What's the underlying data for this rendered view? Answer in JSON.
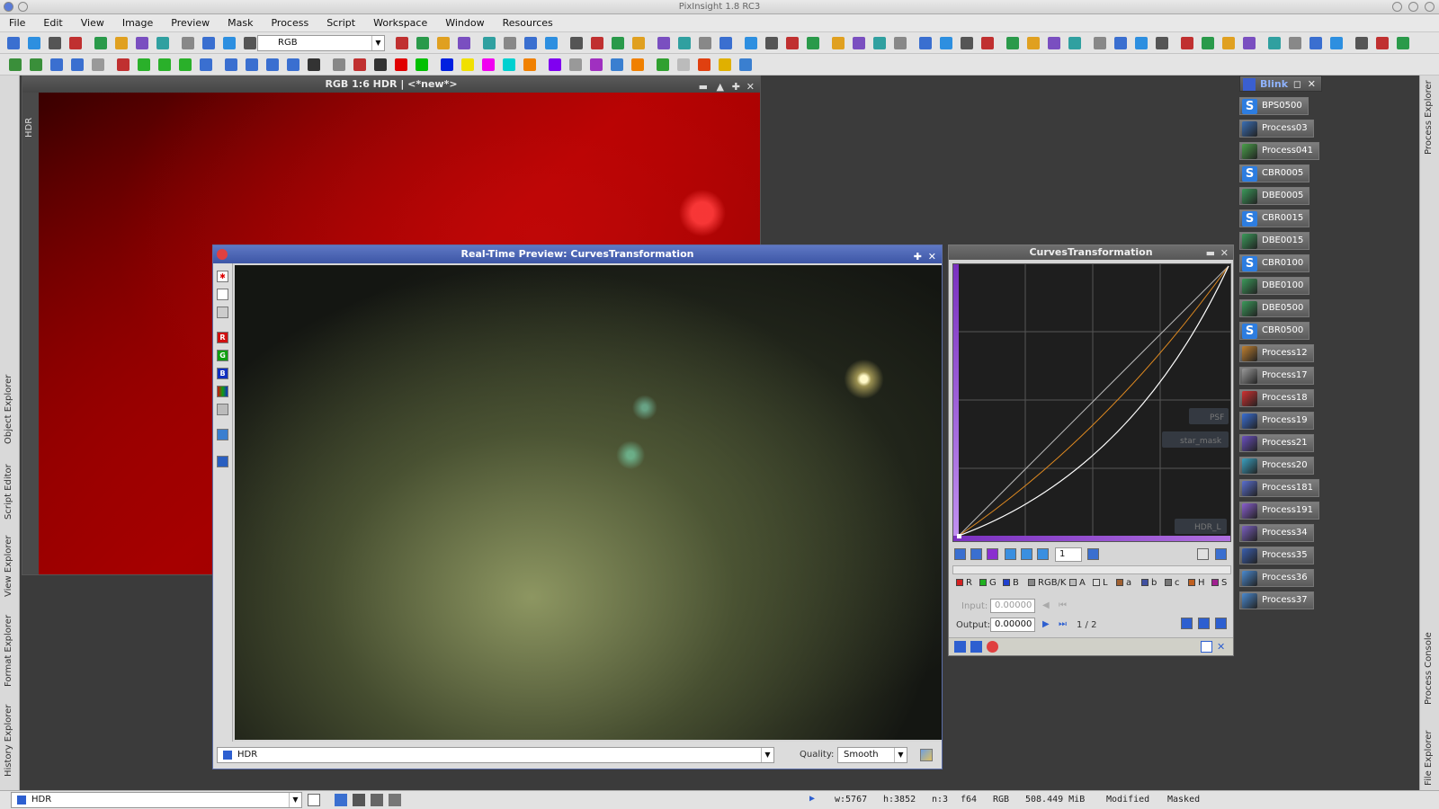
{
  "app": {
    "title": "PixInsight 1.8 RC3"
  },
  "menu": [
    "File",
    "Edit",
    "View",
    "Image",
    "Preview",
    "Mask",
    "Process",
    "Script",
    "Workspace",
    "Window",
    "Resources"
  ],
  "toolbar": {
    "channel_select": "RGB"
  },
  "left_tabs": [
    "Object Explorer",
    "Script Editor",
    "View Explorer",
    "Format Explorer",
    "History Explorer"
  ],
  "right_tabs": [
    "Process Explorer",
    "Process Console",
    "File Explorer"
  ],
  "image_window": {
    "title": "RGB 1:6 HDR | <*new*>",
    "side_tab": "HDR"
  },
  "preview_window": {
    "title": "Real-Time Preview: CurvesTransformation",
    "view_select": "HDR",
    "quality_label": "Quality:",
    "quality_value": "Smooth",
    "tools": [
      "R",
      "G",
      "B"
    ]
  },
  "curves_window": {
    "title": "CurvesTransformation",
    "zoom_value": "1",
    "channels": [
      {
        "label": "R",
        "color": "#d42020"
      },
      {
        "label": "G",
        "color": "#20b020"
      },
      {
        "label": "B",
        "color": "#2040d0"
      },
      {
        "label": "RGB/K",
        "color": "#888888"
      },
      {
        "label": "A",
        "color": "#bbbbbb"
      },
      {
        "label": "L",
        "color": "#dddddd"
      },
      {
        "label": "a",
        "color": "#a06030"
      },
      {
        "label": "b",
        "color": "#4050a0"
      },
      {
        "label": "c",
        "color": "#777777"
      },
      {
        "label": "H",
        "color": "#c06020"
      },
      {
        "label": "S",
        "color": "#a02090"
      }
    ],
    "input_label": "Input:",
    "input_value": "0.00000",
    "output_label": "Output:",
    "output_value": "0.00000",
    "point_counter": "1 / 2",
    "overlay_icons": [
      "PSF",
      "star_mask",
      "HDR_L"
    ]
  },
  "blink": {
    "title": "Blink"
  },
  "process_icons": [
    {
      "label": "BPS0500",
      "icon": "S",
      "color": "#2d7de0"
    },
    {
      "label": "Process03",
      "icon": "img",
      "color": "#3a6fb5"
    },
    {
      "label": "Process041",
      "icon": "crop",
      "color": "#4aa04a"
    },
    {
      "label": "CBR0005",
      "icon": "S",
      "color": "#2d7de0"
    },
    {
      "label": "DBE0005",
      "icon": "img",
      "color": "#3b9a5a"
    },
    {
      "label": "CBR0015",
      "icon": "S",
      "color": "#2d7de0"
    },
    {
      "label": "DBE0015",
      "icon": "img",
      "color": "#3b9a5a"
    },
    {
      "label": "CBR0100",
      "icon": "S",
      "color": "#2d7de0"
    },
    {
      "label": "DBE0100",
      "icon": "img",
      "color": "#3b9a5a"
    },
    {
      "label": "DBE0500",
      "icon": "img",
      "color": "#3b9a5a"
    },
    {
      "label": "CBR0500",
      "icon": "S",
      "color": "#2d7de0"
    },
    {
      "label": "Process12",
      "icon": "img",
      "color": "#c08030"
    },
    {
      "label": "Process17",
      "icon": "img",
      "color": "#999999"
    },
    {
      "label": "Process18",
      "icon": "img",
      "color": "#d03030"
    },
    {
      "label": "Process19",
      "icon": "img",
      "color": "#3a6fd5"
    },
    {
      "label": "Process21",
      "icon": "img",
      "color": "#6a4fc0"
    },
    {
      "label": "Process20",
      "icon": "img",
      "color": "#3aa0c0"
    },
    {
      "label": "Process181",
      "icon": "img",
      "color": "#5a6fd0"
    },
    {
      "label": "Process191",
      "icon": "img",
      "color": "#8a5fd0"
    },
    {
      "label": "Process34",
      "icon": "img",
      "color": "#7a5fc0"
    },
    {
      "label": "Process35",
      "icon": "img",
      "color": "#3a5fb0"
    },
    {
      "label": "Process36",
      "icon": "img",
      "color": "#4a8ad0"
    },
    {
      "label": "Process37",
      "icon": "img",
      "color": "#4a8ad0"
    }
  ],
  "status": {
    "view_select": "HDR",
    "width": "w:5767",
    "height": "h:3852",
    "channels": "n:3",
    "format": "f64",
    "color_space": "RGB",
    "memory": "508.449 MiB",
    "state1": "Modified",
    "state2": "Masked"
  }
}
